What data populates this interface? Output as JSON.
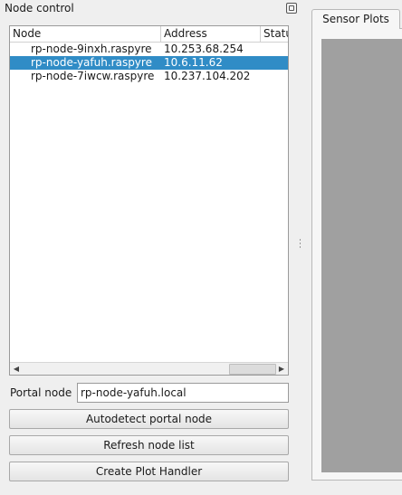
{
  "dock": {
    "title": "Node control"
  },
  "node_table": {
    "columns": [
      "Node",
      "Address",
      "Status"
    ],
    "rows": [
      {
        "node": "rp-node-9inxh.raspyre",
        "address": "10.253.68.254",
        "selected": false
      },
      {
        "node": "rp-node-yafuh.raspyre",
        "address": "10.6.11.62",
        "selected": true
      },
      {
        "node": "rp-node-7iwcw.raspyre",
        "address": "10.237.104.202",
        "selected": false
      }
    ]
  },
  "portal": {
    "label": "Portal node",
    "value": "rp-node-yafuh.local"
  },
  "buttons": {
    "autodetect": "Autodetect portal node",
    "refresh": "Refresh node list",
    "create_plot": "Create Plot Handler"
  },
  "tabs": {
    "active": "Sensor Plots"
  },
  "colors": {
    "selection": "#308cc6",
    "plot_background": "#a0a0a0"
  }
}
